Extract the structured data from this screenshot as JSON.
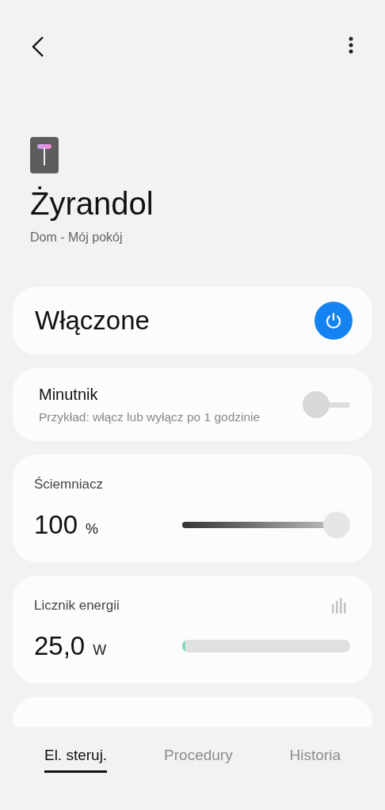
{
  "device": {
    "name": "Żyrandol",
    "location": "Dom - Mój pokój"
  },
  "power": {
    "label": "Włączone",
    "on": true
  },
  "timer": {
    "title": "Minutnik",
    "hint": "Przykład: włącz lub wyłącz po 1 godzinie",
    "on": false
  },
  "dimmer": {
    "title": "Ściemniacz",
    "value": "100",
    "unit": "%",
    "level": 1
  },
  "energy": {
    "title": "Licznik energii",
    "value": "25,0",
    "unit": "W",
    "level": 0.02
  },
  "tabs": [
    {
      "label": "El. steruj.",
      "selected": true
    },
    {
      "label": "Procedury",
      "selected": false
    },
    {
      "label": "Historia",
      "selected": false
    }
  ]
}
